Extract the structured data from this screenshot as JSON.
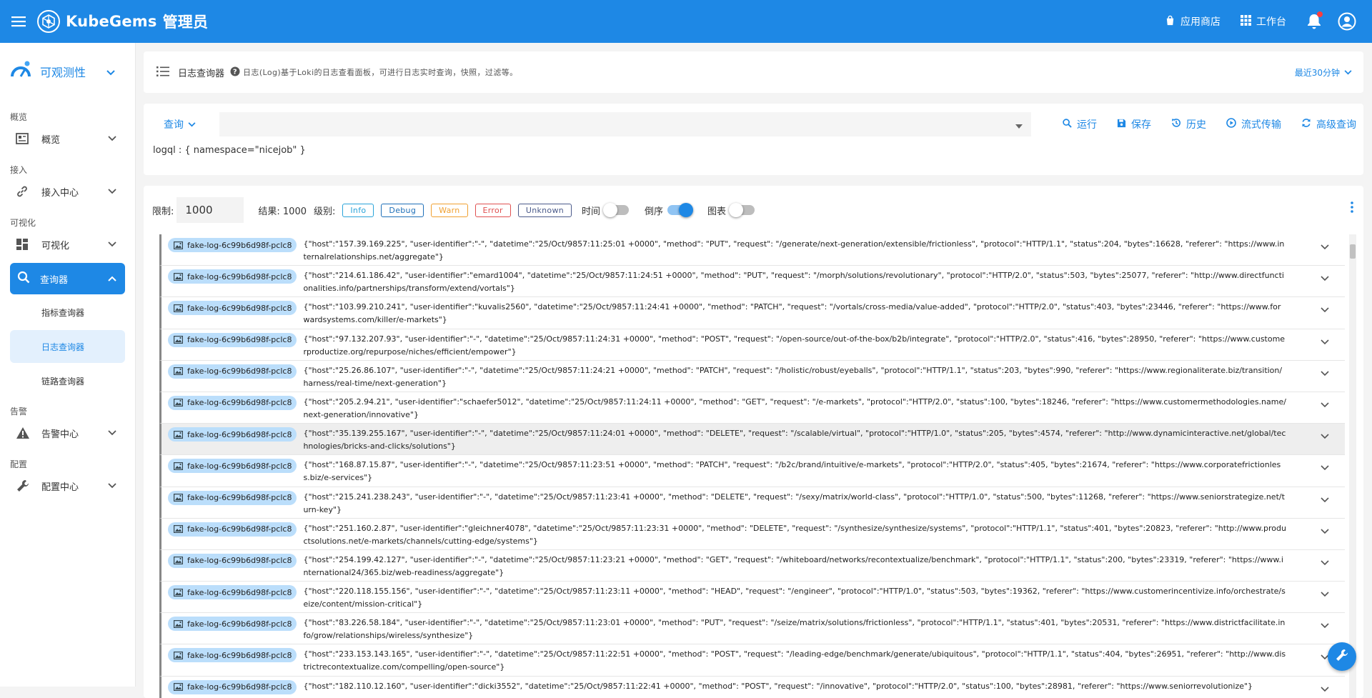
{
  "topbar": {
    "app_name": "KubeGems",
    "role": "管理员",
    "app_store": "应用商店",
    "workspace": "工作台"
  },
  "sidebar": {
    "module": "可观测性",
    "sections": [
      {
        "title": "概览",
        "item": "概览"
      },
      {
        "title": "接入",
        "item": "接入中心"
      },
      {
        "title": "可视化",
        "item": "可视化"
      }
    ],
    "active_group": "查询器",
    "sub_items": [
      "指标查询器",
      "日志查询器",
      "链路查询器"
    ],
    "bottom_sections": [
      {
        "title": "告警",
        "item": "告警中心"
      },
      {
        "title": "配置",
        "item": "配置中心"
      }
    ]
  },
  "header": {
    "title": "日志查询器",
    "hint": "日志(Log)基于Loki的日志查看面板，可进行日志实时查询，快照，过滤等。",
    "time_range": "最近30分钟"
  },
  "query": {
    "mode": "查询",
    "input_value": "",
    "buttons": [
      "运行",
      "保存",
      "历史",
      "流式传输",
      "高级查询"
    ],
    "logql": "logql : { namespace=\"nicejob\" }"
  },
  "toolbar": {
    "limit_label": "限制:",
    "limit_value": "1000",
    "result_text": "结果: 1000",
    "level_label": "级别:",
    "levels": [
      {
        "label": "Info",
        "color": "#29a3d9"
      },
      {
        "label": "Debug",
        "color": "#1e6fb8"
      },
      {
        "label": "Warn",
        "color": "#f0a030"
      },
      {
        "label": "Error",
        "color": "#e05050"
      },
      {
        "label": "Unknown",
        "color": "#4a5a8a"
      }
    ],
    "time_label": "时间",
    "time_on": false,
    "reverse_label": "倒序",
    "reverse_on": true,
    "chart_label": "图表",
    "chart_on": false
  },
  "logs": [
    {
      "pod": "fake-log-6c99b6d98f-pclc8",
      "text": "{\"host\":\"157.39.169.225\", \"user-identifier\":\"-\", \"datetime\":\"25/Oct/9857:11:25:01 +0000\", \"method\": \"PUT\", \"request\": \"/generate/next-generation/extensible/frictionless\", \"protocol\":\"HTTP/1.1\", \"status\":204, \"bytes\":16628, \"referer\": \"https://www.internalrelationships.net/aggregate\"}"
    },
    {
      "pod": "fake-log-6c99b6d98f-pclc8",
      "text": "{\"host\":\"214.61.186.42\", \"user-identifier\":\"emard1004\", \"datetime\":\"25/Oct/9857:11:24:51 +0000\", \"method\": \"PUT\", \"request\": \"/morph/solutions/revolutionary\", \"protocol\":\"HTTP/2.0\", \"status\":503, \"bytes\":25077, \"referer\": \"http://www.directfunctionalities.info/partnerships/transform/extend/vortals\"}"
    },
    {
      "pod": "fake-log-6c99b6d98f-pclc8",
      "text": "{\"host\":\"103.99.210.241\", \"user-identifier\":\"kuvalis2560\", \"datetime\":\"25/Oct/9857:11:24:41 +0000\", \"method\": \"PATCH\", \"request\": \"/vortals/cross-media/value-added\", \"protocol\":\"HTTP/2.0\", \"status\":403, \"bytes\":23446, \"referer\": \"https://www.forwardsystems.com/killer/e-markets\"}"
    },
    {
      "pod": "fake-log-6c99b6d98f-pclc8",
      "text": "{\"host\":\"97.132.207.93\", \"user-identifier\":\"-\", \"datetime\":\"25/Oct/9857:11:24:31 +0000\", \"method\": \"POST\", \"request\": \"/open-source/out-of-the-box/b2b/integrate\", \"protocol\":\"HTTP/2.0\", \"status\":416, \"bytes\":28950, \"referer\": \"https://www.customerproductize.org/repurpose/niches/efficient/empower\"}"
    },
    {
      "pod": "fake-log-6c99b6d98f-pclc8",
      "text": "{\"host\":\"25.26.86.107\", \"user-identifier\":\"-\", \"datetime\":\"25/Oct/9857:11:24:21 +0000\", \"method\": \"PATCH\", \"request\": \"/holistic/robust/eyeballs\", \"protocol\":\"HTTP/1.1\", \"status\":203, \"bytes\":990, \"referer\": \"https://www.regionaliterate.biz/transition/harness/real-time/next-generation\"}"
    },
    {
      "pod": "fake-log-6c99b6d98f-pclc8",
      "text": "{\"host\":\"205.2.94.21\", \"user-identifier\":\"schaefer5012\", \"datetime\":\"25/Oct/9857:11:24:11 +0000\", \"method\": \"GET\", \"request\": \"/e-markets\", \"protocol\":\"HTTP/2.0\", \"status\":100, \"bytes\":18246, \"referer\": \"https://www.customermethodologies.name/next-generation/innovative\"}"
    },
    {
      "pod": "fake-log-6c99b6d98f-pclc8",
      "text": "{\"host\":\"35.139.255.167\", \"user-identifier\":\"-\", \"datetime\":\"25/Oct/9857:11:24:01 +0000\", \"method\": \"DELETE\", \"request\": \"/scalable/virtual\", \"protocol\":\"HTTP/1.0\", \"status\":205, \"bytes\":4574, \"referer\": \"http://www.dynamicinteractive.net/global/technologies/bricks-and-clicks/solutions\"}"
    },
    {
      "pod": "fake-log-6c99b6d98f-pclc8",
      "text": "{\"host\":\"168.87.15.87\", \"user-identifier\":\"-\", \"datetime\":\"25/Oct/9857:11:23:51 +0000\", \"method\": \"PATCH\", \"request\": \"/b2c/brand/intuitive/e-markets\", \"protocol\":\"HTTP/2.0\", \"status\":405, \"bytes\":21674, \"referer\": \"https://www.corporatefrictionless.biz/e-services\"}"
    },
    {
      "pod": "fake-log-6c99b6d98f-pclc8",
      "text": "{\"host\":\"215.241.238.243\", \"user-identifier\":\"-\", \"datetime\":\"25/Oct/9857:11:23:41 +0000\", \"method\": \"DELETE\", \"request\": \"/sexy/matrix/world-class\", \"protocol\":\"HTTP/1.0\", \"status\":500, \"bytes\":11268, \"referer\": \"https://www.seniorstrategize.net/turn-key\"}"
    },
    {
      "pod": "fake-log-6c99b6d98f-pclc8",
      "text": "{\"host\":\"251.160.2.87\", \"user-identifier\":\"gleichner4078\", \"datetime\":\"25/Oct/9857:11:23:31 +0000\", \"method\": \"DELETE\", \"request\": \"/synthesize/synthesize/systems\", \"protocol\":\"HTTP/1.1\", \"status\":401, \"bytes\":20823, \"referer\": \"http://www.productsolutions.net/e-markets/channels/cutting-edge/systems\"}"
    },
    {
      "pod": "fake-log-6c99b6d98f-pclc8",
      "text": "{\"host\":\"254.199.42.127\", \"user-identifier\":\"-\", \"datetime\":\"25/Oct/9857:11:23:21 +0000\", \"method\": \"GET\", \"request\": \"/whiteboard/networks/recontextualize/benchmark\", \"protocol\":\"HTTP/1.1\", \"status\":200, \"bytes\":23319, \"referer\": \"https://www.international24/365.biz/web-readiness/aggregate\"}"
    },
    {
      "pod": "fake-log-6c99b6d98f-pclc8",
      "text": "{\"host\":\"220.118.155.156\", \"user-identifier\":\"-\", \"datetime\":\"25/Oct/9857:11:23:11 +0000\", \"method\": \"HEAD\", \"request\": \"/engineer\", \"protocol\":\"HTTP/1.0\", \"status\":503, \"bytes\":19362, \"referer\": \"https://www.customerincentivize.info/orchestrate/seize/content/mission-critical\"}"
    },
    {
      "pod": "fake-log-6c99b6d98f-pclc8",
      "text": "{\"host\":\"83.226.58.184\", \"user-identifier\":\"-\", \"datetime\":\"25/Oct/9857:11:23:01 +0000\", \"method\": \"PUT\", \"request\": \"/seize/matrix/solutions/frictionless\", \"protocol\":\"HTTP/1.1\", \"status\":401, \"bytes\":20531, \"referer\": \"https://www.districtfacilitate.info/grow/relationships/wireless/synthesize\"}"
    },
    {
      "pod": "fake-log-6c99b6d98f-pclc8",
      "text": "{\"host\":\"233.153.143.165\", \"user-identifier\":\"-\", \"datetime\":\"25/Oct/9857:11:22:51 +0000\", \"method\": \"POST\", \"request\": \"/leading-edge/benchmark/generate/ubiquitous\", \"protocol\":\"HTTP/1.1\", \"status\":404, \"bytes\":26951, \"referer\": \"http://www.districtrecontextualize.com/compelling/open-source\"}"
    },
    {
      "pod": "fake-log-6c99b6d98f-pclc8",
      "text": "{\"host\":\"182.110.12.160\", \"user-identifier\":\"dicki3552\", \"datetime\":\"25/Oct/9857:11:22:41 +0000\", \"method\": \"POST\", \"request\": \"/innovative\", \"protocol\":\"HTTP/2.0\", \"status\":100, \"bytes\":28981, \"referer\": \"https://www.seniorrevolutionize\"}"
    }
  ]
}
